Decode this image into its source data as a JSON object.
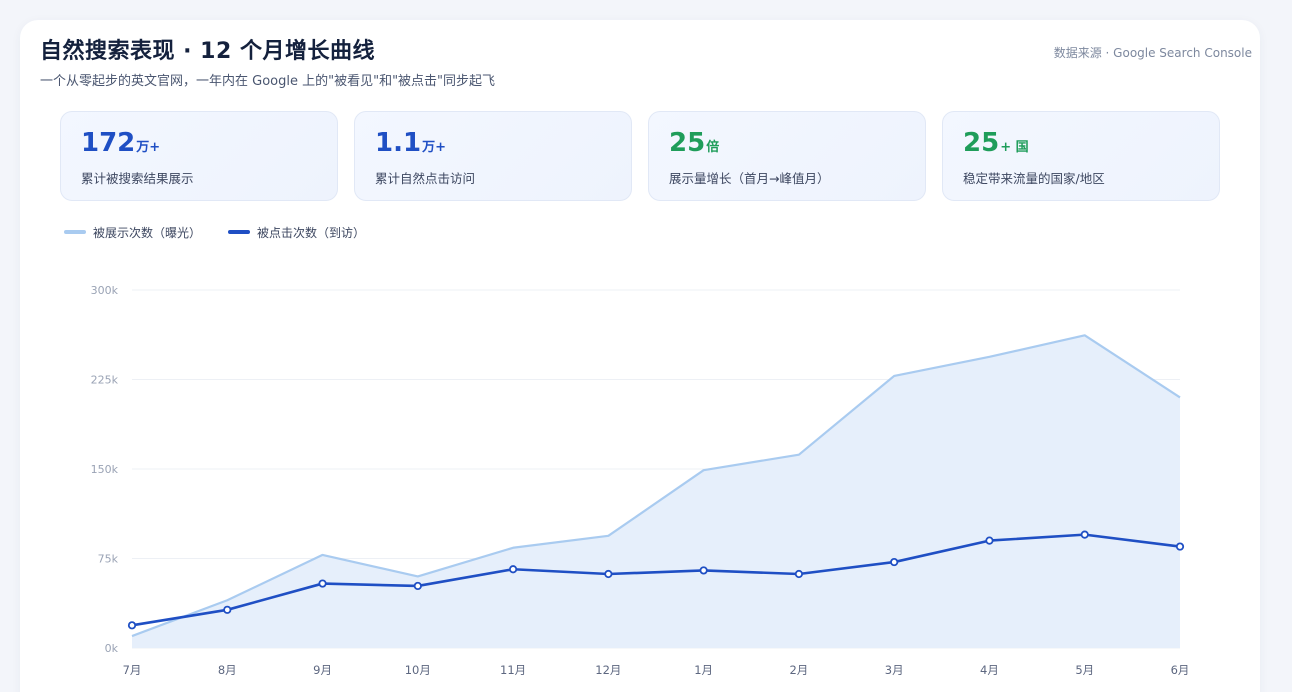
{
  "header": {
    "title": "自然搜索表现 · 12 个月增长曲线",
    "subtitle": "一个从零起步的英文官网，一年内在 Google 上的\"被看见\"和\"被点击\"同步起飞",
    "source": "数据来源 · Google Search Console"
  },
  "stats": [
    {
      "value": "172",
      "unit": "万+",
      "desc": "累计被搜索结果展示",
      "color": "#1f4fc4"
    },
    {
      "value": "1.1",
      "unit": "万+",
      "desc": "累计自然点击访问",
      "color": "#1f4fc4"
    },
    {
      "value": "25",
      "unit": "倍",
      "desc": "展示量增长（首月→峰值月）",
      "color": "#1f9d5a"
    },
    {
      "value": "25",
      "unit": "+ 国",
      "desc": "稳定带来流量的国家/地区",
      "color": "#1f9d5a"
    }
  ],
  "legend": {
    "impressions": "被展示次数（曝光）",
    "clicks": "被点击次数（到访）"
  },
  "colors": {
    "impressions_line": "#a9cbf0",
    "impressions_fill": "#e6effb",
    "clicks_line": "#1f4fc4",
    "grid": "#edf0f5"
  },
  "chart_data": {
    "type": "line",
    "categories": [
      "7月",
      "8月",
      "9月",
      "10月",
      "11月",
      "12月",
      "1月",
      "2月",
      "3月",
      "4月",
      "5月",
      "6月"
    ],
    "ylim": [
      0,
      300000
    ],
    "yticks": [
      0,
      75000,
      150000,
      225000,
      300000
    ],
    "ytick_labels": [
      "0k",
      "75k",
      "150k",
      "225k",
      "300k"
    ],
    "grid": true,
    "legend_position": "top-left",
    "series": [
      {
        "name": "被展示次数（曝光）",
        "type": "area",
        "values": [
          10000,
          40000,
          78000,
          60000,
          84000,
          94000,
          149000,
          162000,
          228000,
          244000,
          262000,
          210000
        ]
      },
      {
        "name": "被点击次数（到访）",
        "type": "line",
        "markers": true,
        "values": [
          19000,
          32000,
          54000,
          52000,
          66000,
          62000,
          65000,
          62000,
          72000,
          90000,
          95000,
          85000
        ]
      }
    ]
  }
}
